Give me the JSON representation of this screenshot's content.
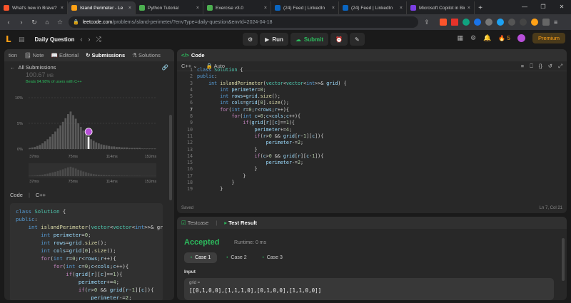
{
  "browser": {
    "tabs": [
      {
        "title": "What's new in Brave? | Br",
        "color": "#fb542b",
        "active": false
      },
      {
        "title": "Island Perimeter - Le",
        "color": "#ffa116",
        "active": true
      },
      {
        "title": "Python Tutorial",
        "color": "#4caf50",
        "active": false
      },
      {
        "title": "Exercise v3.0",
        "color": "#4caf50",
        "active": false
      },
      {
        "title": "(24) Feed | LinkedIn",
        "color": "#0a66c2",
        "active": false
      },
      {
        "title": "(24) Feed | LinkedIn",
        "color": "#0a66c2",
        "active": false
      },
      {
        "title": "Microsoft Copilot in Bing",
        "color": "#7b3fe4",
        "active": false
      }
    ],
    "url_host": "leetcode.com",
    "url_path": "/problems/island-perimeter/?envType=daily-question&envId=2024-04-18"
  },
  "header": {
    "daily": "Daily Question",
    "run": "Run",
    "submit": "Submit",
    "streak": "5",
    "premium": "Premium"
  },
  "left": {
    "tabs": [
      "tion",
      "Note",
      "Editorial",
      "Submissions",
      "Solutions"
    ],
    "all_submissions": "All Submissions",
    "memory": "100.67",
    "memory_unit": "MB",
    "beats": "Beats 94.98% of users with C++",
    "code_label": "Code",
    "lang": "C++"
  },
  "chart_data": {
    "type": "bar",
    "title": "",
    "xlabel": "",
    "ylabel": "",
    "y_ticks": [
      "10%",
      "5%",
      "0%"
    ],
    "x_ticks": [
      "37ms",
      "75ms",
      "114ms",
      "152ms"
    ],
    "ylim": [
      0,
      10
    ],
    "values": [
      0.2,
      0.3,
      0.4,
      0.6,
      0.8,
      1.1,
      1.5,
      1.9,
      2.4,
      2.9,
      3.4,
      4.0,
      4.6,
      5.3,
      6.0,
      6.8,
      7.3,
      6.6,
      5.9,
      5.0,
      4.3,
      3.6,
      3.0,
      2.4,
      1.9,
      1.6,
      1.3,
      1.1,
      0.9,
      0.8,
      0.7,
      0.6,
      0.5,
      0.5,
      0.4,
      0.4,
      0.3,
      0.3,
      0.3,
      0.2,
      0.2,
      0.2,
      0.2,
      0.2,
      0.1,
      0.1,
      0.1,
      0.1,
      0.1,
      0.1
    ],
    "highlight_index": 23
  },
  "code_panel": {
    "title": "Code",
    "lang": "C++",
    "auto": "Auto",
    "saved": "Saved",
    "cursor": "Ln 7, Col 21"
  },
  "code_lines": [
    "class Solution {",
    "public:",
    "    int islandPerimeter(vector<vector<int>>& grid) {",
    "        int perimeter=0;",
    "        int rows=grid.size();",
    "        int cols=grid[0].size();",
    "        for(int r=0;r<rows;r++){",
    "            for(int c=0;c<cols;c++){",
    "                if(grid[r][c]==1){",
    "                    perimeter+=4;",
    "                    if(r>0 && grid[r-1][c]){",
    "                        perimeter-=2;",
    "                    }",
    "                    if(c>0 && grid[r][c-1]){",
    "                        perimeter-=2;",
    "                    }",
    "                }",
    "            }",
    "        }"
  ],
  "left_code_lines": [
    "class Solution {",
    "public:",
    "    int islandPerimeter(vector<vector<int>>& gri",
    "        int perimeter=0;",
    "        int rows=grid.size();",
    "        int cols=grid[0].size();",
    "        for(int r=0;r<rows;r++){",
    "            for(int c=0;c<cols;c++){",
    "                if(grid[r][c]==1){",
    "                    perimeter+=4;",
    "                    if(r>0 && grid[r-1][c]){",
    "                        perimeter-=2;",
    "                    }"
  ],
  "result": {
    "tab_testcase": "Testcase",
    "tab_result": "Test Result",
    "status": "Accepted",
    "runtime": "Runtime: 0 ms",
    "cases": [
      "Case 1",
      "Case 2",
      "Case 3"
    ],
    "input_label": "Input",
    "input_key": "grid =",
    "input_value": "[[0,1,0,0],[1,1,1,0],[0,1,0,0],[1,1,0,0]]"
  },
  "colors": {
    "accent": "#ffa116",
    "green": "#2cbb5d"
  }
}
